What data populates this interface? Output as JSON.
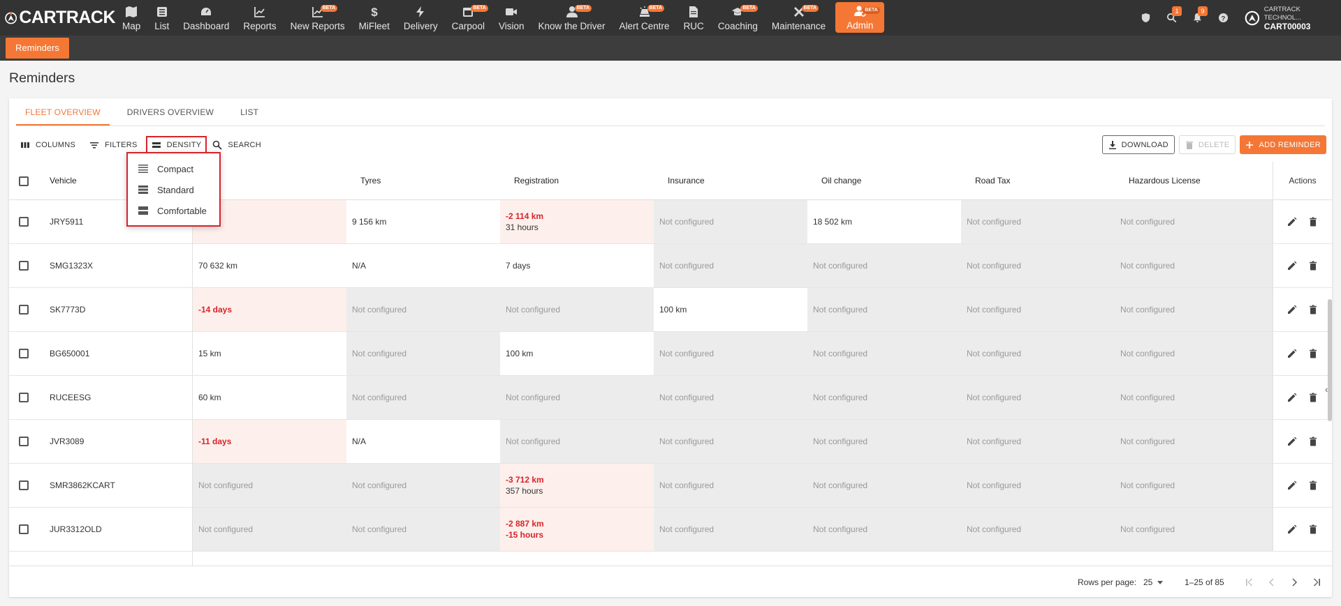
{
  "brand": {
    "name": "CARTRACK",
    "accent": "#f47735"
  },
  "nav": [
    {
      "label": "Map",
      "icon": "map-icon",
      "beta": false
    },
    {
      "label": "List",
      "icon": "list-icon",
      "beta": false
    },
    {
      "label": "Dashboard",
      "icon": "dashboard-icon",
      "beta": false
    },
    {
      "label": "Reports",
      "icon": "reports-icon",
      "beta": false
    },
    {
      "label": "New Reports",
      "icon": "new-reports-icon",
      "beta": true
    },
    {
      "label": "MiFleet",
      "icon": "dollar-icon",
      "beta": false
    },
    {
      "label": "Delivery",
      "icon": "lightning-icon",
      "beta": false
    },
    {
      "label": "Carpool",
      "icon": "calendar-icon",
      "beta": true
    },
    {
      "label": "Vision",
      "icon": "camera-icon",
      "beta": false
    },
    {
      "label": "Know the Driver",
      "icon": "driver-icon",
      "beta": true
    },
    {
      "label": "Alert Centre",
      "icon": "alert-icon",
      "beta": true
    },
    {
      "label": "RUC",
      "icon": "document-icon",
      "beta": false
    },
    {
      "label": "Coaching",
      "icon": "coaching-icon",
      "beta": true
    },
    {
      "label": "Maintenance",
      "icon": "wrench-icon",
      "beta": true
    },
    {
      "label": "Admin",
      "icon": "admin-icon",
      "beta": true,
      "active": true
    }
  ],
  "beta_label": "BETA",
  "top_right": {
    "badge_search": "1",
    "badge_notifications": "9",
    "account_company": "CARTRACK TECHNOL...",
    "account_id": "CART00003"
  },
  "subtab": "Reminders",
  "page_title": "Reminders",
  "tabs": [
    "FLEET OVERVIEW",
    "DRIVERS OVERVIEW",
    "LIST"
  ],
  "toolbar": {
    "columns": "COLUMNS",
    "filters": "FILTERS",
    "density": "DENSITY",
    "search": "SEARCH"
  },
  "actions": {
    "download": "DOWNLOAD",
    "delete": "DELETE",
    "add": "ADD REMINDER"
  },
  "density_menu": [
    "Compact",
    "Standard",
    "Comfortable"
  ],
  "table": {
    "headers": [
      "Vehicle",
      "e",
      "Tyres",
      "Registration",
      "Insurance",
      "Oil change",
      "Road Tax",
      "Hazardous License"
    ],
    "actions_header": "Actions",
    "rows": [
      {
        "vehicle": "JRY5911",
        "cells": [
          {
            "t": "ays",
            "k": "red"
          },
          {
            "t": "9 156 km",
            "k": "white"
          },
          {
            "t": "-2 114 km",
            "s": "31 hours",
            "k": "red"
          },
          {
            "t": "Not configured",
            "k": "gray"
          },
          {
            "t": "18 502 km",
            "k": "white"
          },
          {
            "t": "Not configured",
            "k": "gray"
          },
          {
            "t": "Not configured",
            "k": "gray"
          }
        ]
      },
      {
        "vehicle": "SMG1323X",
        "cells": [
          {
            "t": "70 632 km",
            "k": "white"
          },
          {
            "t": "N/A",
            "k": "white"
          },
          {
            "t": "7 days",
            "k": "white"
          },
          {
            "t": "Not configured",
            "k": "gray"
          },
          {
            "t": "Not configured",
            "k": "gray"
          },
          {
            "t": "Not configured",
            "k": "gray"
          },
          {
            "t": "Not configured",
            "k": "gray"
          }
        ]
      },
      {
        "vehicle": "SK7773D",
        "cells": [
          {
            "t": "-14 days",
            "k": "red"
          },
          {
            "t": "Not configured",
            "k": "gray"
          },
          {
            "t": "Not configured",
            "k": "gray"
          },
          {
            "t": "100 km",
            "k": "white"
          },
          {
            "t": "Not configured",
            "k": "gray"
          },
          {
            "t": "Not configured",
            "k": "gray"
          },
          {
            "t": "Not configured",
            "k": "gray"
          }
        ]
      },
      {
        "vehicle": "BG650001",
        "cells": [
          {
            "t": "15 km",
            "k": "white"
          },
          {
            "t": "Not configured",
            "k": "gray"
          },
          {
            "t": "100 km",
            "k": "white"
          },
          {
            "t": "Not configured",
            "k": "gray"
          },
          {
            "t": "Not configured",
            "k": "gray"
          },
          {
            "t": "Not configured",
            "k": "gray"
          },
          {
            "t": "Not configured",
            "k": "gray"
          }
        ]
      },
      {
        "vehicle": "RUCEESG",
        "cells": [
          {
            "t": "60 km",
            "k": "white"
          },
          {
            "t": "Not configured",
            "k": "gray"
          },
          {
            "t": "Not configured",
            "k": "gray"
          },
          {
            "t": "Not configured",
            "k": "gray"
          },
          {
            "t": "Not configured",
            "k": "gray"
          },
          {
            "t": "Not configured",
            "k": "gray"
          },
          {
            "t": "Not configured",
            "k": "gray"
          }
        ]
      },
      {
        "vehicle": "JVR3089",
        "cells": [
          {
            "t": "-11 days",
            "k": "red"
          },
          {
            "t": "N/A",
            "k": "white"
          },
          {
            "t": "Not configured",
            "k": "gray"
          },
          {
            "t": "Not configured",
            "k": "gray"
          },
          {
            "t": "Not configured",
            "k": "gray"
          },
          {
            "t": "Not configured",
            "k": "gray"
          },
          {
            "t": "Not configured",
            "k": "gray"
          }
        ]
      },
      {
        "vehicle": "SMR3862KCART",
        "cells": [
          {
            "t": "Not configured",
            "k": "gray"
          },
          {
            "t": "Not configured",
            "k": "gray"
          },
          {
            "t": "-3 712 km",
            "s": "357 hours",
            "k": "red"
          },
          {
            "t": "Not configured",
            "k": "gray"
          },
          {
            "t": "Not configured",
            "k": "gray"
          },
          {
            "t": "Not configured",
            "k": "gray"
          },
          {
            "t": "Not configured",
            "k": "gray"
          }
        ]
      },
      {
        "vehicle": "JUR3312OLD",
        "cells": [
          {
            "t": "Not configured",
            "k": "gray"
          },
          {
            "t": "Not configured",
            "k": "gray"
          },
          {
            "t": "-2 887 km",
            "s": "-15 hours",
            "sred": true,
            "k": "red"
          },
          {
            "t": "Not configured",
            "k": "gray"
          },
          {
            "t": "Not configured",
            "k": "gray"
          },
          {
            "t": "Not configured",
            "k": "gray"
          },
          {
            "t": "Not configured",
            "k": "gray"
          }
        ]
      }
    ]
  },
  "pagination": {
    "rows_per_page_label": "Rows per page:",
    "rows_per_page": "25",
    "range": "1–25 of 85"
  }
}
